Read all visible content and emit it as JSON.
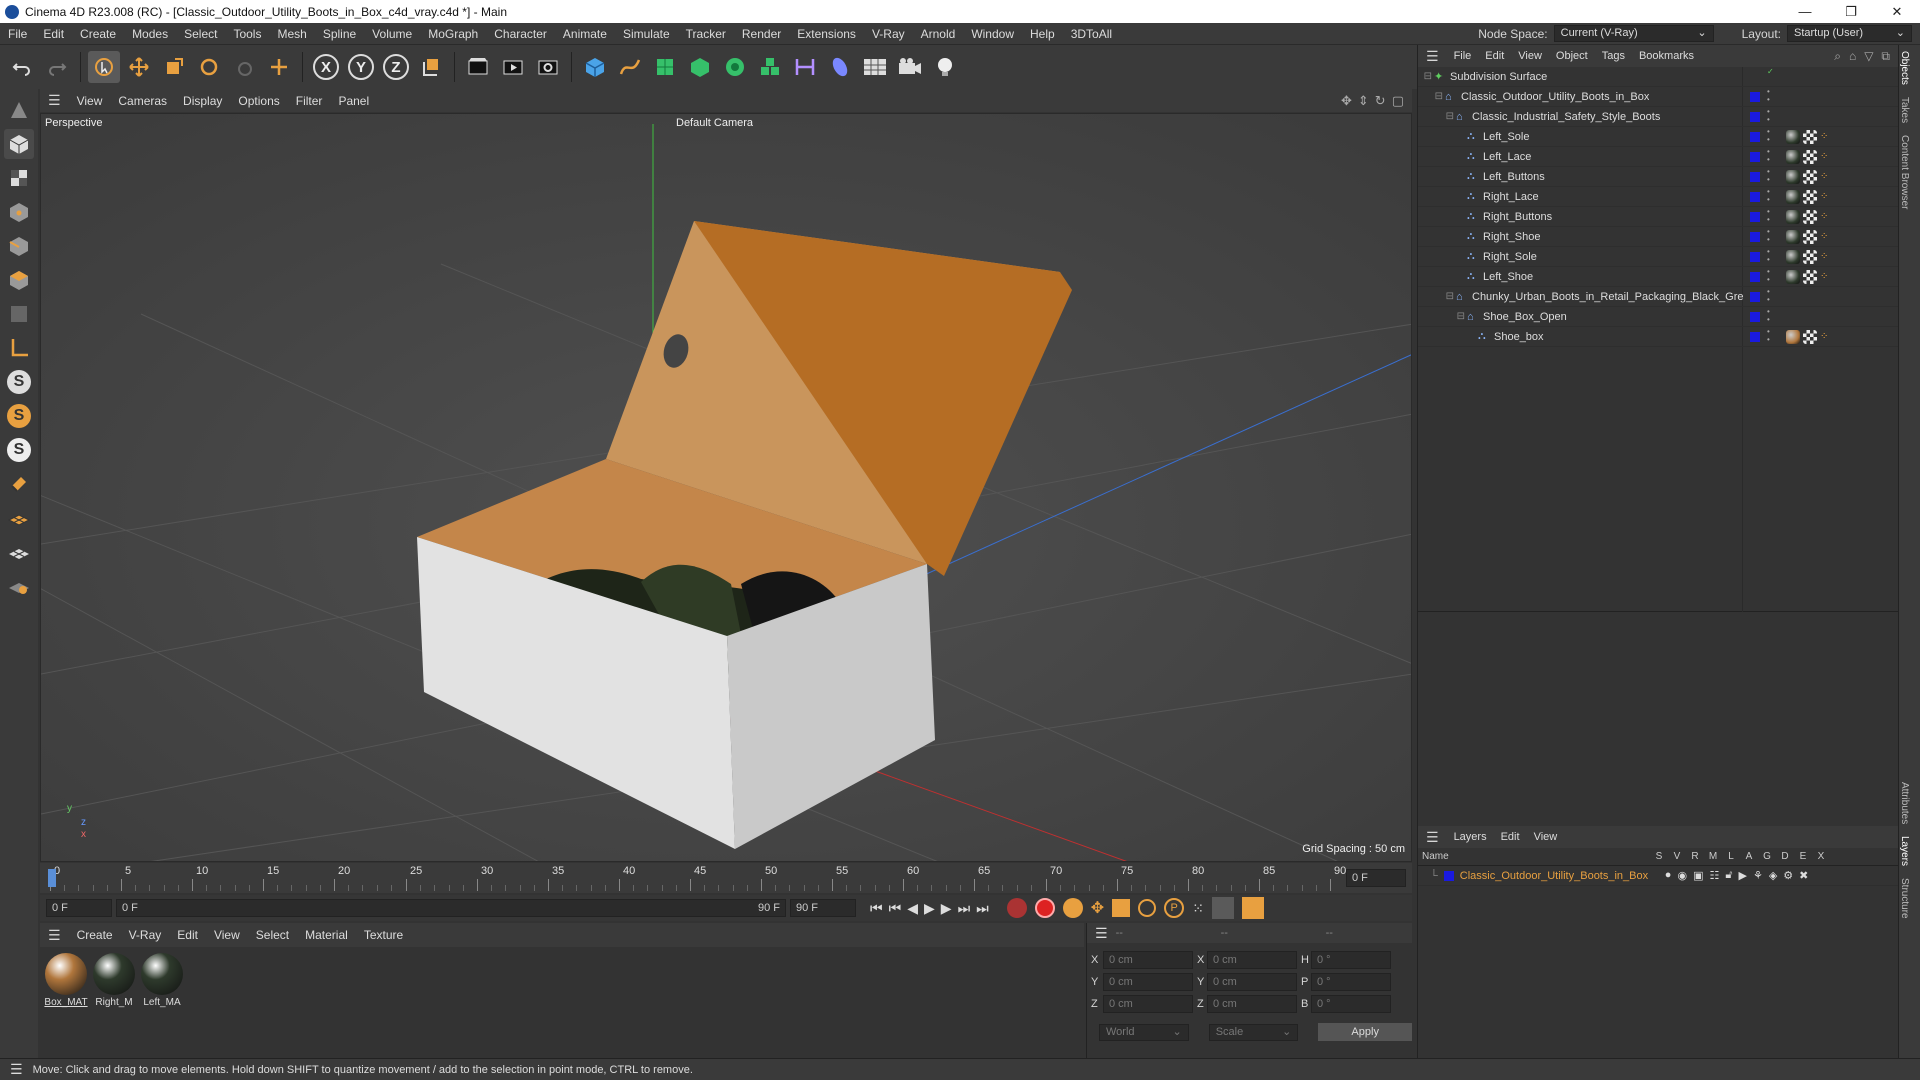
{
  "window": {
    "title": "Cinema 4D R23.008 (RC) - [Classic_Outdoor_Utility_Boots_in_Box_c4d_vray.c4d *] - Main",
    "minimize": "—",
    "maximize": "❐",
    "close": "✕"
  },
  "menu": [
    "File",
    "Edit",
    "Create",
    "Modes",
    "Select",
    "Tools",
    "Mesh",
    "Spline",
    "Volume",
    "MoGraph",
    "Character",
    "Animate",
    "Simulate",
    "Tracker",
    "Render",
    "Extensions",
    "V-Ray",
    "Arnold",
    "Window",
    "Help",
    "3DToAll"
  ],
  "node_space": {
    "label": "Node Space:",
    "value": "Current (V-Ray)"
  },
  "layout": {
    "label": "Layout:",
    "value": "Startup (User)"
  },
  "toolbar": {
    "x": "X",
    "y": "Y",
    "z": "Z"
  },
  "left_tools": {
    "s1": "S",
    "s2": "S",
    "s3": "S"
  },
  "viewport": {
    "menu": [
      "View",
      "Cameras",
      "Display",
      "Options",
      "Filter",
      "Panel"
    ],
    "label": "Perspective",
    "camera": "Default Camera",
    "grid_spacing": "Grid Spacing : 50 cm",
    "axis_y": "y",
    "axis_z": "z",
    "axis_x": "x"
  },
  "timeline": {
    "ticks": [
      "0",
      "5",
      "10",
      "15",
      "20",
      "25",
      "30",
      "35",
      "40",
      "45",
      "50",
      "55",
      "60",
      "65",
      "70",
      "75",
      "80",
      "85",
      "90"
    ],
    "current": "0 F",
    "playhead_fraction": 0.0
  },
  "transport": {
    "start": "0 F",
    "range_start": "0 F",
    "range_end": "90 F",
    "end": "90 F"
  },
  "materials": {
    "menu": [
      "Create",
      "V-Ray",
      "Edit",
      "View",
      "Select",
      "Material",
      "Texture"
    ],
    "items": [
      {
        "label": "Box_MAT",
        "color": "#b0763c"
      },
      {
        "label": "Right_M",
        "color": "#2e3a2c"
      },
      {
        "label": "Left_MA",
        "color": "#2e3a2c"
      }
    ]
  },
  "coords": {
    "headers": [
      "--",
      "--",
      "--"
    ],
    "rows": [
      {
        "a": "X",
        "av": "0 cm",
        "b": "X",
        "bv": "0 cm",
        "c": "H",
        "cv": "0 °"
      },
      {
        "a": "Y",
        "av": "0 cm",
        "b": "Y",
        "bv": "0 cm",
        "c": "P",
        "cv": "0 °"
      },
      {
        "a": "Z",
        "av": "0 cm",
        "b": "Z",
        "bv": "0 cm",
        "c": "B",
        "cv": "0 °"
      }
    ],
    "world": "World",
    "scale": "Scale",
    "apply": "Apply"
  },
  "objects": {
    "menu": [
      "File",
      "Edit",
      "View",
      "Object",
      "Tags",
      "Bookmarks"
    ],
    "rows": [
      {
        "name": "Subdivision Surface",
        "indent": 0,
        "color": "#5fcf5f"
      },
      {
        "name": "Classic_Outdoor_Utility_Boots_in_Box",
        "indent": 1
      },
      {
        "name": "Classic_Industrial_Safety_Style_Boots",
        "indent": 2
      },
      {
        "name": "Left_Sole",
        "indent": 3,
        "tags": true
      },
      {
        "name": "Left_Lace",
        "indent": 3,
        "tags": true
      },
      {
        "name": "Left_Buttons",
        "indent": 3,
        "tags": true
      },
      {
        "name": "Right_Lace",
        "indent": 3,
        "tags": true
      },
      {
        "name": "Right_Buttons",
        "indent": 3,
        "tags": true
      },
      {
        "name": "Right_Shoe",
        "indent": 3,
        "tags": true
      },
      {
        "name": "Right_Sole",
        "indent": 3,
        "tags": true
      },
      {
        "name": "Left_Shoe",
        "indent": 3,
        "tags": true
      },
      {
        "name": "Chunky_Urban_Boots_in_Retail_Packaging_Black_Green",
        "indent": 2
      },
      {
        "name": "Shoe_Box_Open",
        "indent": 3
      },
      {
        "name": "Shoe_box",
        "indent": 4,
        "tags": true,
        "box": true
      }
    ]
  },
  "layers": {
    "menu": [
      "Layers",
      "Edit",
      "View"
    ],
    "header": {
      "name": "Name",
      "flags": [
        "S",
        "V",
        "R",
        "M",
        "L",
        "A",
        "G",
        "D",
        "E",
        "X"
      ]
    },
    "row": "Classic_Outdoor_Utility_Boots_in_Box"
  },
  "side_tabs": [
    "Objects",
    "Takes",
    "Content Browser",
    "Attributes",
    "Layers",
    "Structure"
  ],
  "status": "Move: Click and drag to move elements. Hold down SHIFT to quantize movement / add to the selection in point mode, CTRL to remove."
}
